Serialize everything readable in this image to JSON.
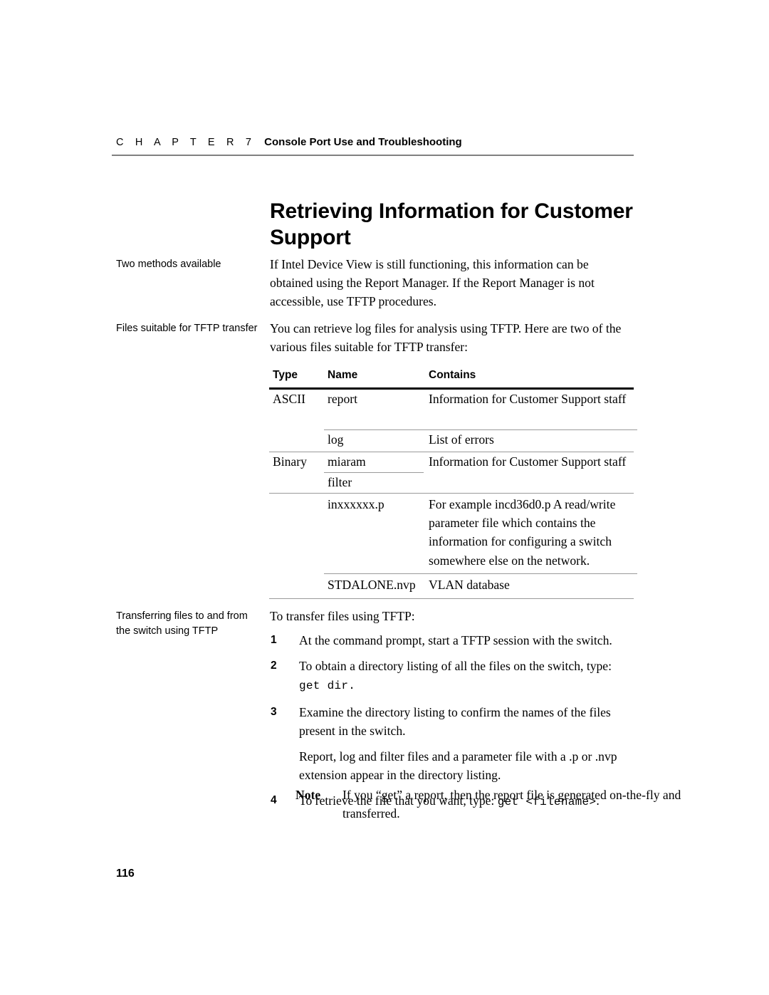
{
  "header": {
    "chapter_word": "C H A P T E R  7",
    "chapter_title": "Console Port Use and Troubleshooting"
  },
  "title": "Retrieving Information for Customer Support",
  "margin_notes": {
    "note1": "Two methods available",
    "note2": "Files suitable for TFTP transfer",
    "note3": "Transferring files to and from the switch using TFTP"
  },
  "body": {
    "para1": "If Intel Device View is still functioning, this information can be obtained using the Report Manager. If the Report Manager is not accessible, use TFTP procedures.",
    "para2": "You can retrieve log files for analysis using TFTP. Here are two of the various files suitable for TFTP transfer:",
    "para3": "To transfer files using TFTP:"
  },
  "table": {
    "headers": {
      "type": "Type",
      "name": "Name",
      "contains": "Contains"
    },
    "rows": [
      {
        "type": "ASCII",
        "name": "report",
        "contains": "Information for Customer Support staff"
      },
      {
        "type": "",
        "name": "log",
        "contains": "List of errors"
      },
      {
        "type": "Binary",
        "name": "miaram",
        "contains": "Information for Customer Support staff"
      },
      {
        "type": "",
        "name": "filter",
        "contains": ""
      },
      {
        "type": "",
        "name": "inxxxxxx.p",
        "contains": "For example incd36d0.p A read/write parameter file which contains the information for configuring a switch somewhere else on the network."
      },
      {
        "type": "",
        "name": "STDALONE.nvp",
        "contains": "VLAN database"
      }
    ]
  },
  "steps": [
    {
      "num": "1",
      "text": "At the command prompt, start a TFTP session with the switch.",
      "code": "",
      "tail": ""
    },
    {
      "num": "2",
      "text": "To obtain a directory listing of all the files on the switch, type:",
      "code": "get dir.",
      "tail": ""
    },
    {
      "num": "3",
      "text": "Examine the directory listing to confirm the names of the files present in the switch.",
      "code": "",
      "tail": ""
    },
    {
      "num": "4",
      "text": "To retrieve the file that you want, type:",
      "code": "get <filename>",
      "tail": "."
    }
  ],
  "step3_continuation": "Report, log and filter files and a parameter file with a .p or .nvp extension appear in the directory listing.",
  "note": {
    "label": "Note",
    "text": "If you “get” a report, then the report file is generated on-the-fly and transferred."
  },
  "folio": "116"
}
